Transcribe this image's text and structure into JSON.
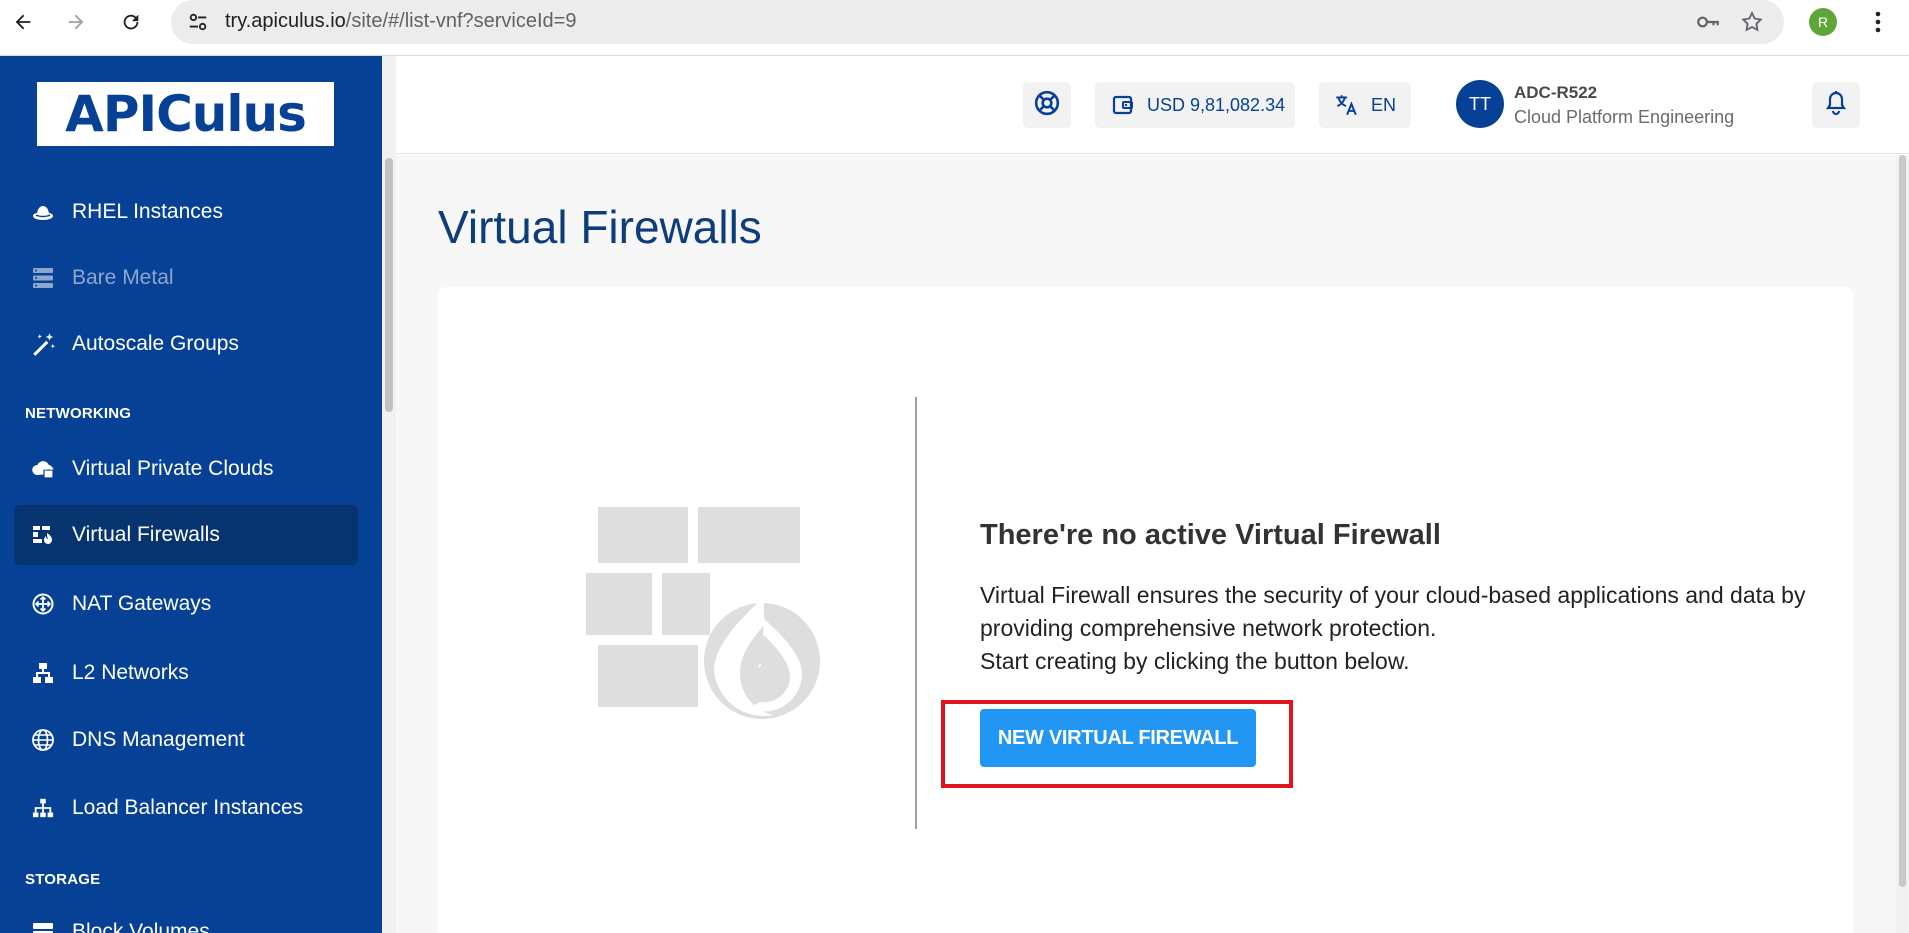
{
  "browser": {
    "url_host": "try.apiculus.io",
    "url_path": "/site/#/list-vnf?serviceId=9",
    "profile_initial": "R"
  },
  "sidebar": {
    "logo_text": "APICulus",
    "items_top": [
      {
        "label": "RHEL Instances",
        "icon": "redhat-icon",
        "disabled": false
      },
      {
        "label": "Bare Metal",
        "icon": "server-icon",
        "disabled": true
      },
      {
        "label": "Autoscale Groups",
        "icon": "magic-wand-icon",
        "disabled": false
      }
    ],
    "section_networking": "NETWORKING",
    "items_networking": [
      {
        "label": "Virtual Private Clouds",
        "icon": "cloud-lock-icon"
      },
      {
        "label": "Virtual Firewalls",
        "icon": "firewall-icon",
        "active": true
      },
      {
        "label": "NAT Gateways",
        "icon": "nat-gateway-icon"
      },
      {
        "label": "L2 Networks",
        "icon": "network-tree-icon"
      },
      {
        "label": "DNS Management",
        "icon": "globe-icon"
      },
      {
        "label": "Load Balancer Instances",
        "icon": "sitemap-icon"
      }
    ],
    "section_storage": "STORAGE",
    "items_storage": [
      {
        "label": "Block Volumes",
        "icon": "block-volume-icon"
      }
    ]
  },
  "header": {
    "wallet_amount": "USD 9,81,082.34",
    "language": "EN",
    "avatar_initials": "TT",
    "user_name": "ADC-R522",
    "user_org": "Cloud Platform Engineering"
  },
  "main": {
    "page_title": "Virtual Firewalls",
    "empty_title": "There're no active Virtual Firewall",
    "empty_desc_line1": "Virtual Firewall ensures the security of your cloud-based applications and data by providing comprehensive network protection.",
    "empty_desc_line2": "Start creating by clicking the button below.",
    "new_button_label": "NEW VIRTUAL FIREWALL"
  },
  "colors": {
    "sidebar_bg": "#064196",
    "active_item_bg": "#05346f",
    "primary_button": "#2196f3",
    "highlight_border": "#e0141e",
    "title_color": "#0d3d7a"
  }
}
